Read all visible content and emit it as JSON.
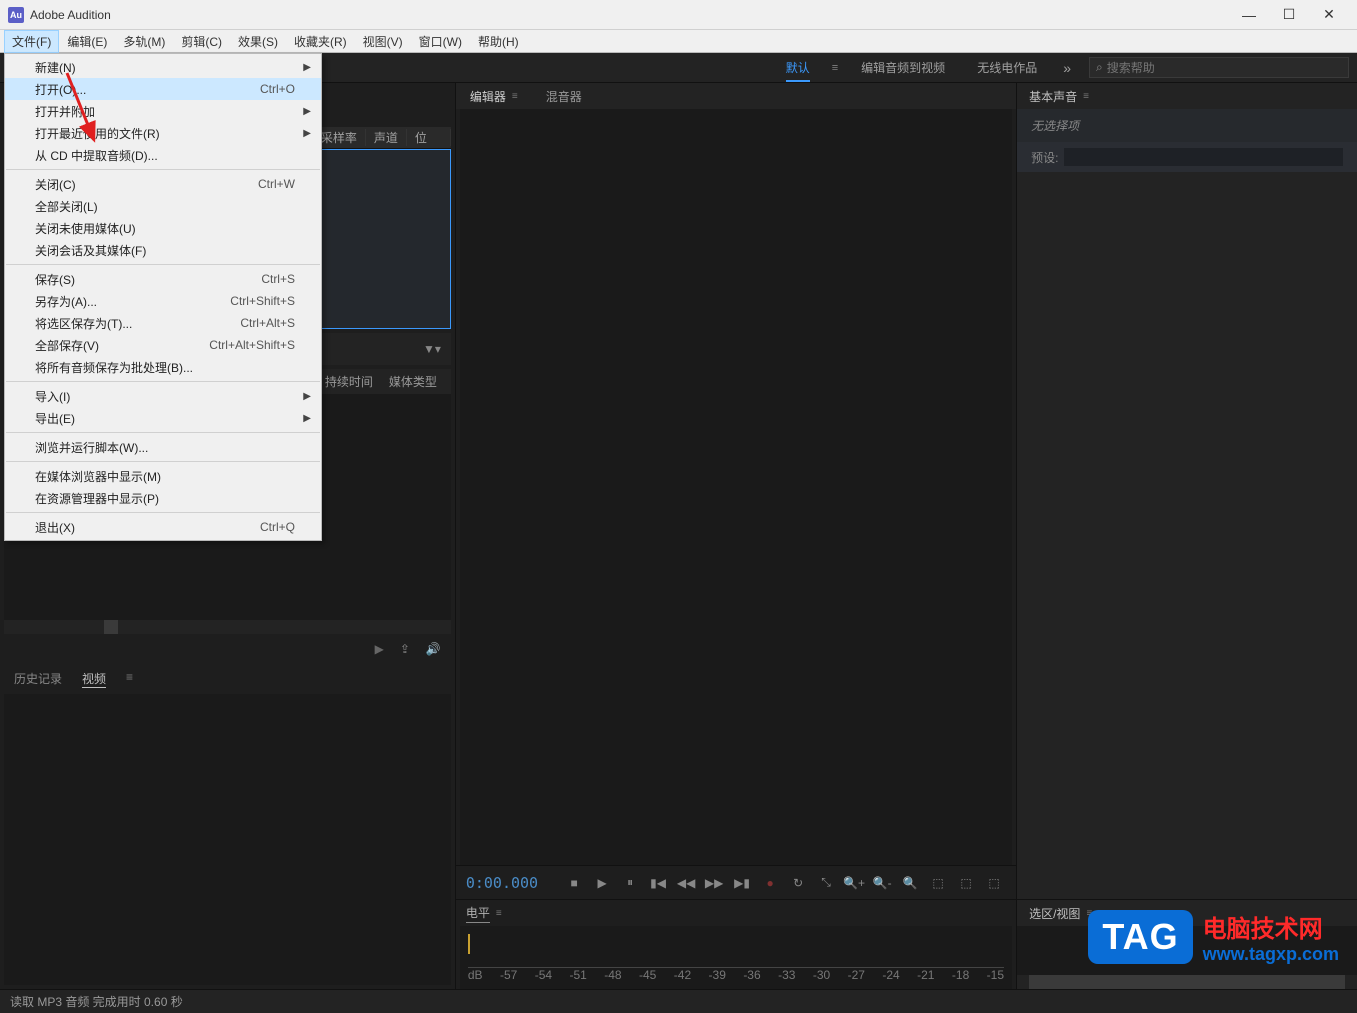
{
  "app": {
    "title": "Adobe Audition",
    "icon_text": "Au"
  },
  "win": {
    "min": "—",
    "max": "☐",
    "close": "✕"
  },
  "menu": {
    "file": "文件(F)",
    "edit": "编辑(E)",
    "multi": "多轨(M)",
    "clip": "剪辑(C)",
    "effects": "效果(S)",
    "fav": "收藏夹(R)",
    "view": "视图(V)",
    "window": "窗口(W)",
    "help": "帮助(H)"
  },
  "workspaces": {
    "default": "默认",
    "editav": "编辑音频到视频",
    "radio": "无线电作品",
    "more": "»"
  },
  "search": {
    "placeholder": "搜索帮助"
  },
  "file_menu": {
    "new": "新建(N)",
    "open": "打开(O)...",
    "open_sc": "Ctrl+O",
    "open_append": "打开并附加",
    "open_recent": "打开最近使用的文件(R)",
    "extract_cd": "从 CD 中提取音频(D)...",
    "close": "关闭(C)",
    "close_sc": "Ctrl+W",
    "close_all": "全部关闭(L)",
    "close_unused": "关闭未使用媒体(U)",
    "close_session": "关闭会话及其媒体(F)",
    "save": "保存(S)",
    "save_sc": "Ctrl+S",
    "save_as": "另存为(A)...",
    "save_as_sc": "Ctrl+Shift+S",
    "save_selection": "将选区保存为(T)...",
    "save_selection_sc": "Ctrl+Alt+S",
    "save_all": "全部保存(V)",
    "save_all_sc": "Ctrl+Alt+Shift+S",
    "save_batch": "将所有音频保存为批处理(B)...",
    "import": "导入(I)",
    "export": "导出(E)",
    "scripts": "浏览并运行脚本(W)...",
    "reveal_media": "在媒体浏览器中显示(M)",
    "reveal_explorer": "在资源管理器中显示(P)",
    "exit": "退出(X)",
    "exit_sc": "Ctrl+Q"
  },
  "files_panel": {
    "col_rate": "采样率",
    "col_channels": "声道",
    "col_bits": "位"
  },
  "media_panel": {
    "col_duration": "持续时间",
    "col_type": "媒体类型"
  },
  "history_tabs": {
    "history": "历史记录",
    "video": "视频"
  },
  "editor_tabs": {
    "editor": "编辑器",
    "mixer": "混音器"
  },
  "timecode": "0:00.000",
  "level_panel": {
    "title": "电平"
  },
  "level_ticks": [
    "dB",
    "-57",
    "-54",
    "-51",
    "-48",
    "-45",
    "-42",
    "-39",
    "-36",
    "-33",
    "-30",
    "-27",
    "-24",
    "-21",
    "-18",
    "-15"
  ],
  "right": {
    "title": "基本声音",
    "noselect": "无选择项",
    "preset": "预设:",
    "selview": "选区/视图"
  },
  "status": "读取 MP3 音频 完成用时 0.60 秒",
  "watermark": {
    "tag": "TAG",
    "cn": "电脑技术网",
    "en": "www.tagxp.com"
  }
}
